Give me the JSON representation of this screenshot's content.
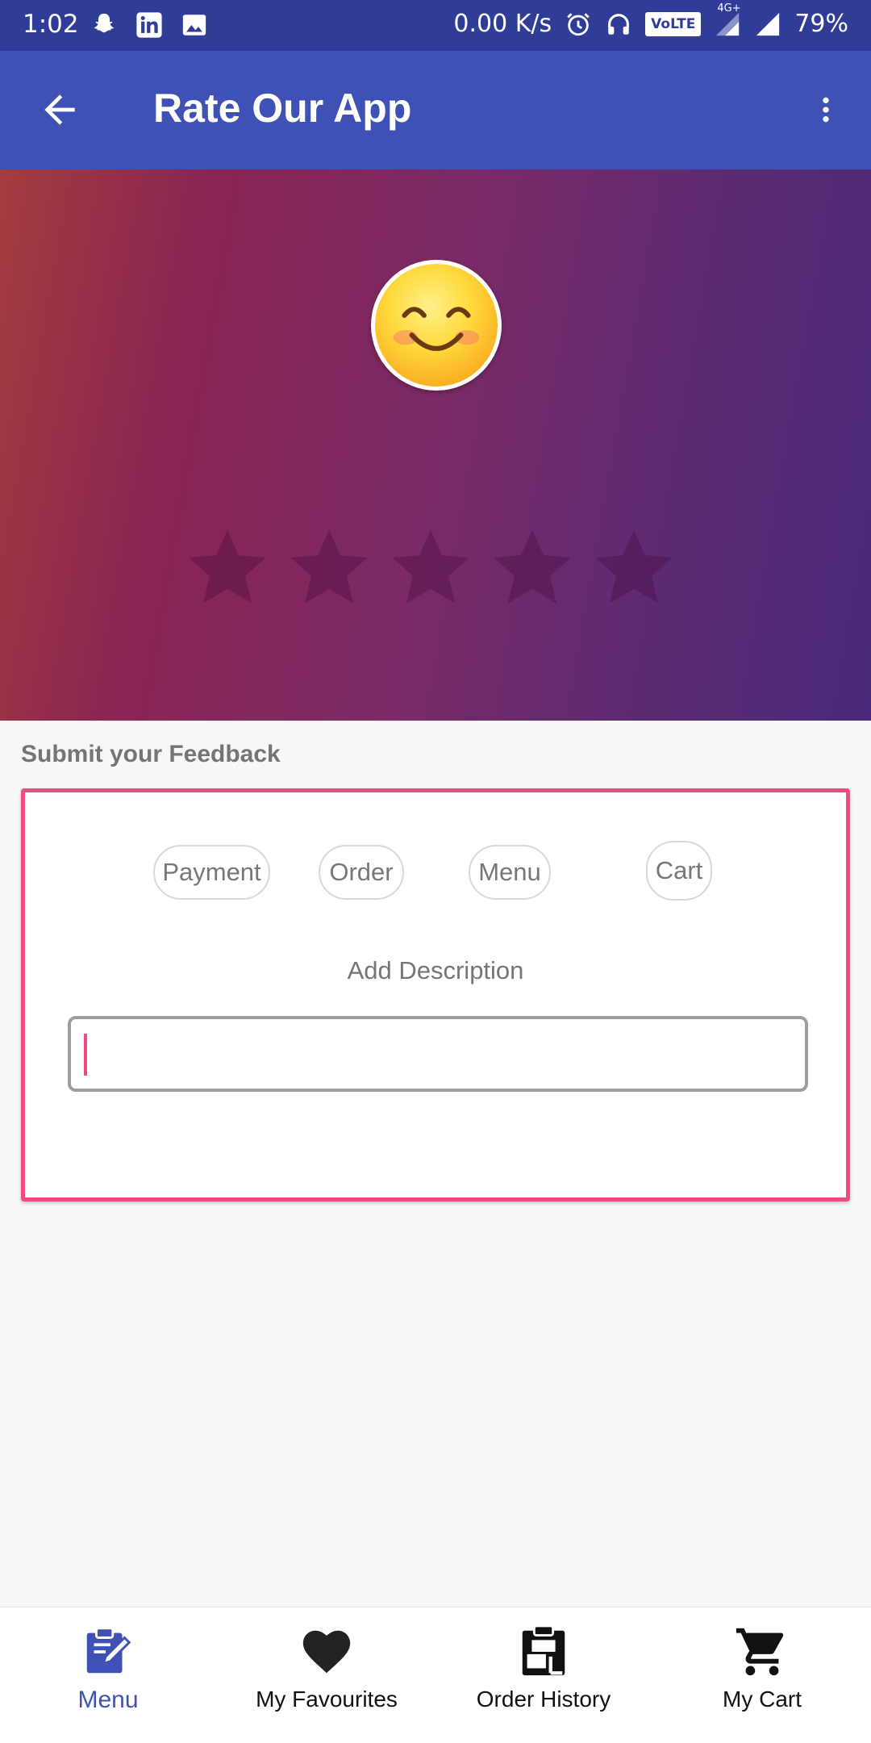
{
  "status_bar": {
    "time": "1:02",
    "network_speed": "0.00 K/s",
    "volte": "VoLTE",
    "network_type": "4G+",
    "battery": "79%",
    "left_icons": [
      "snapchat-icon",
      "linkedin-icon",
      "image-icon"
    ],
    "right_icons": [
      "alarm-icon",
      "headset-icon",
      "volte-icon",
      "signal-4g-icon",
      "signal-icon"
    ]
  },
  "toolbar": {
    "title": "Rate Our App",
    "back_icon": "arrow-back-icon",
    "menu_icon": "more-vertical-icon"
  },
  "rating": {
    "emoji": "smiling-face-icon",
    "stars": 5,
    "selected": 0
  },
  "feedback": {
    "label": "Submit your Feedback",
    "chips": [
      "Payment",
      "Order",
      "Menu",
      "Cart"
    ],
    "add_description": "Add Description",
    "description_value": ""
  },
  "bottom_nav": {
    "items": [
      {
        "label": "Menu",
        "icon": "edit-clipboard-icon",
        "active": true
      },
      {
        "label": "My Favourites",
        "icon": "heart-icon",
        "active": false
      },
      {
        "label": "Order History",
        "icon": "order-history-icon",
        "active": false
      },
      {
        "label": "My Cart",
        "icon": "cart-icon",
        "active": false
      }
    ]
  },
  "colors": {
    "status_bar": "#2f3c98",
    "toolbar": "#3f51b5",
    "accent_pink": "#f04b81",
    "active_nav": "#3f51b5"
  }
}
